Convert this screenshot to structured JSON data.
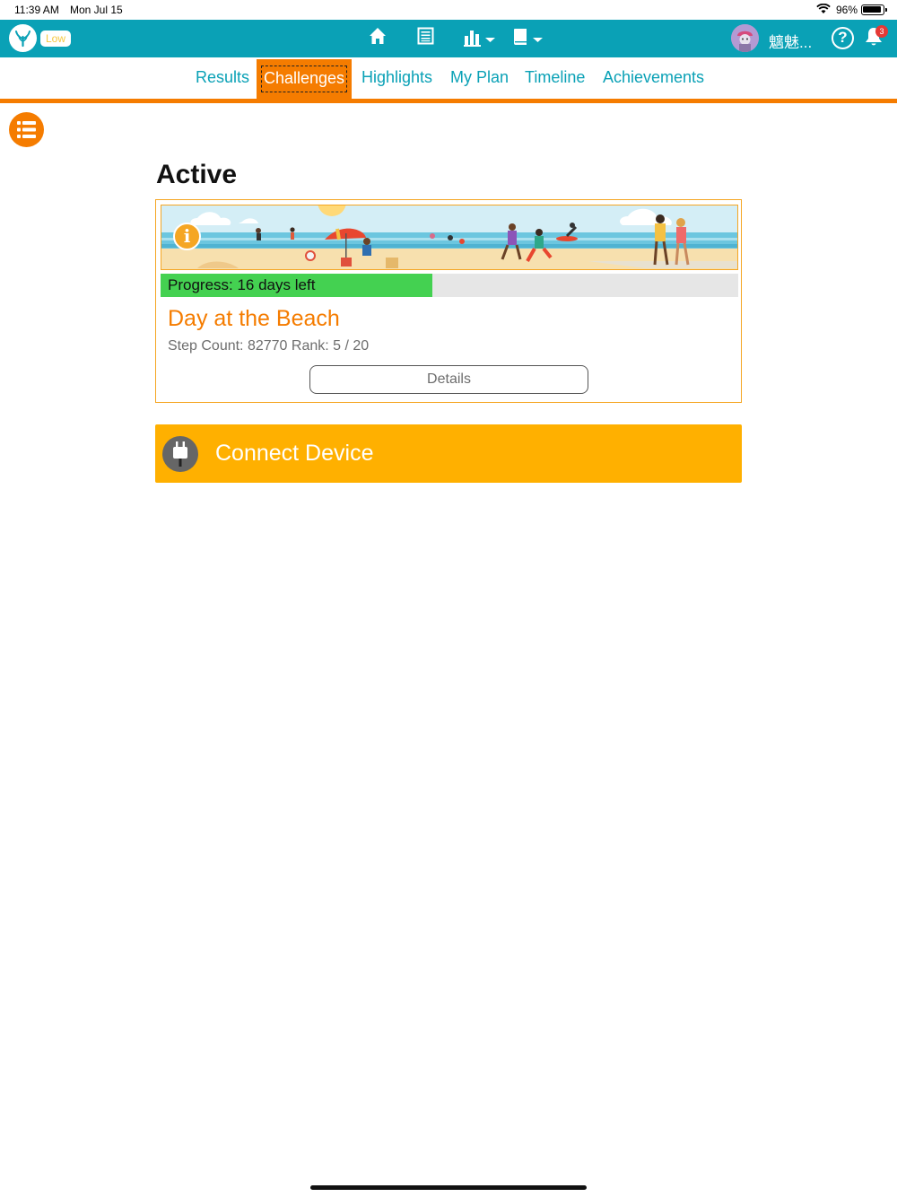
{
  "status_bar": {
    "time": "11:39 AM",
    "date": "Mon Jul 15",
    "battery_percent": "96%",
    "battery_level": 0.96
  },
  "top_nav": {
    "status_badge": "Low",
    "user_name": "魑魅...",
    "notification_count": "3",
    "icons": [
      "logo-icon",
      "home-icon",
      "journal-icon",
      "chart-dropdown-icon",
      "book-dropdown-icon",
      "avatar",
      "help-icon",
      "bell-icon"
    ],
    "brand_color": "#0aa1b6"
  },
  "tabs": [
    {
      "label": "Results",
      "active": false
    },
    {
      "label": "Challenges",
      "active": true
    },
    {
      "label": "Highlights",
      "active": false
    },
    {
      "label": "My Plan",
      "active": false
    },
    {
      "label": "Timeline",
      "active": false
    },
    {
      "label": "Achievements",
      "active": false
    }
  ],
  "accent_color": "#f57c00",
  "main": {
    "section_title": "Active",
    "challenge": {
      "progress_label": "Progress: 16 days left",
      "progress_fraction": 0.47,
      "title": "Day at the Beach",
      "meta": "Step Count: 82770 Rank: 5 / 20",
      "details_label": "Details"
    },
    "connect_device_label": "Connect Device"
  }
}
